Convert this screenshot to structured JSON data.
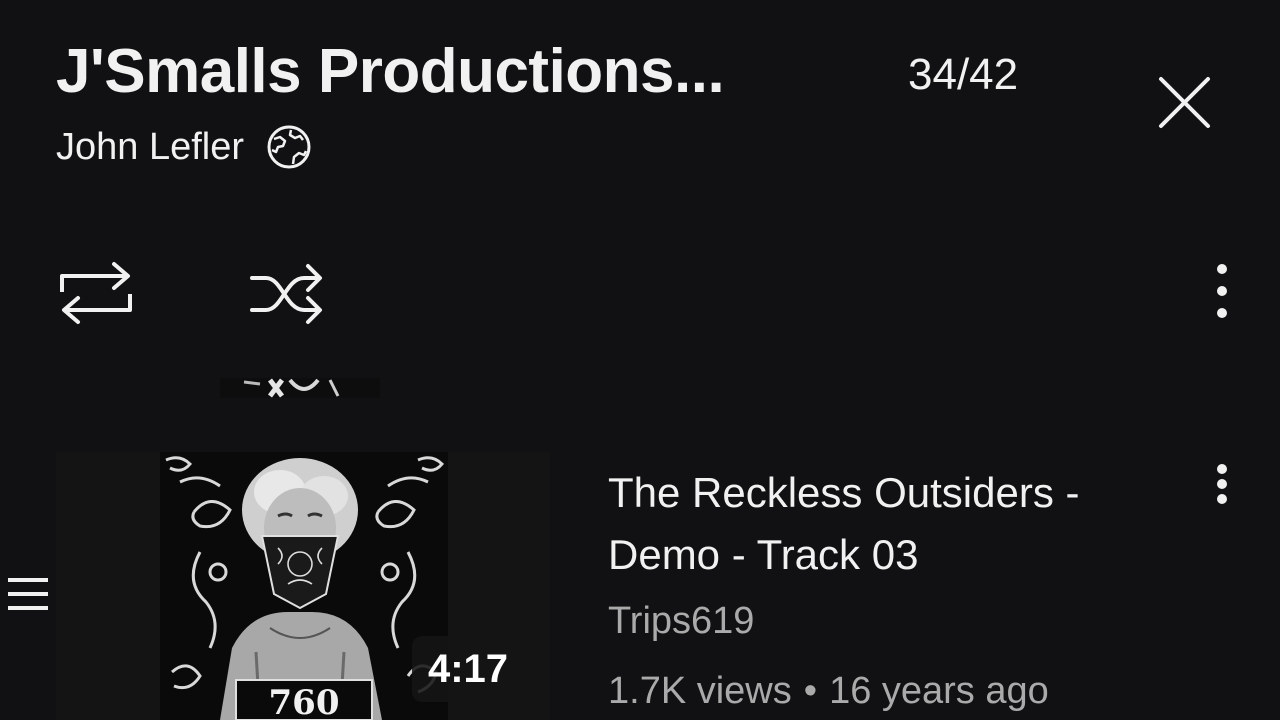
{
  "header": {
    "playlist_title": "J'Smalls Productions...",
    "position": "34/42",
    "owner": "John Lefler",
    "close_icon": "close-icon",
    "visibility_icon": "globe-icon"
  },
  "controls": {
    "loop_icon": "repeat-icon",
    "shuffle_icon": "shuffle-icon",
    "menu_icon": "more-vert-icon"
  },
  "items": [
    {
      "title": "The Reckless Outsiders - Demo - Track 03",
      "channel": "Trips619",
      "views": "1.7K views",
      "separator": "•",
      "age": "16 years ago",
      "duration": "4:17",
      "thumb_text": "760"
    }
  ],
  "colors": {
    "background": "#111012",
    "primary_text": "#f1f1f1",
    "secondary_text": "#aaaaaa"
  }
}
